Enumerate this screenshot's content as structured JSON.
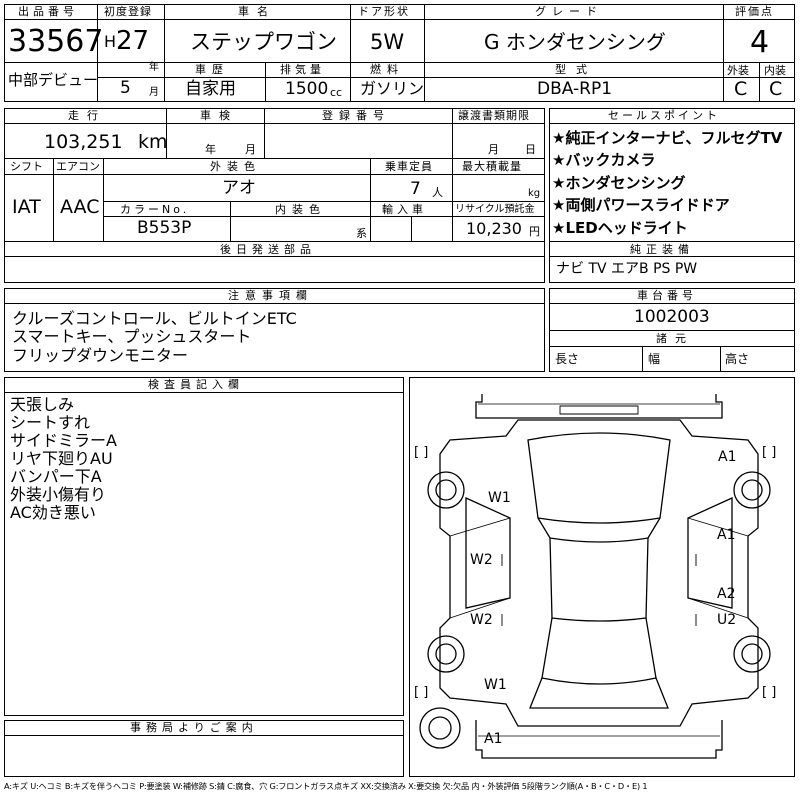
{
  "header": {
    "lot_label": "出品番号",
    "lot_number": "33567",
    "region": "中部デビュー",
    "first_reg_label": "初度登録",
    "era": "H",
    "year": "27",
    "year_unit": "年",
    "month": "5",
    "month_unit": "月",
    "car_name_label": "車名",
    "car_name": "ステップワゴン",
    "door_label": "ドア形状",
    "door": "5W",
    "grade_label": "グレード",
    "grade": "G ホンダセンシング",
    "score_label": "評価点",
    "score": "4",
    "history_label": "車歴",
    "history": "自家用",
    "displacement_label": "排気量",
    "displacement": "1500",
    "displacement_unit": "cc",
    "fuel_label": "燃料",
    "fuel": "ガソリン",
    "model_label": "型式",
    "model": "DBA-RP1",
    "exterior_grade_label": "外装",
    "interior_grade_label": "内装",
    "exterior_grade": "C",
    "interior_grade": "C"
  },
  "row2": {
    "mileage_label": "走行",
    "mileage": "103,251",
    "mileage_unit": "km",
    "inspection_label": "車検",
    "inspection_year_unit": "年",
    "inspection_month_unit": "月",
    "reg_no_label": "登録番号",
    "transfer_label": "譲渡書類期限",
    "transfer_month_unit": "月",
    "transfer_day_unit": "日",
    "shift_label": "シフト",
    "shift": "IAT",
    "ac_label": "エアコン",
    "ac": "AAC",
    "color_label": "外装色",
    "color": "アオ",
    "capacity_label": "乗車定員",
    "capacity": "7",
    "capacity_unit": "人",
    "max_load_label": "最大積載量",
    "max_load_unit": "kg",
    "color_no_label": "カラーNo.",
    "color_no": "B553P",
    "interior_color_label": "内装色",
    "interior_color_unit": "系",
    "import_label": "輸入車",
    "recycle_label": "リサイクル預託金",
    "recycle": "10,230",
    "recycle_unit": "円",
    "later_parts_label": "後日発送部品"
  },
  "sales_points": {
    "label": "セールスポイント",
    "items": [
      "★純正インターナビ、フルセグTV",
      "★バックカメラ",
      "★ホンダセンシング",
      "★両側パワースライドドア",
      "★LEDヘッドライト"
    ]
  },
  "equipment": {
    "label": "純正装備",
    "value": "ナビ TV エアB PS PW"
  },
  "notes": {
    "label": "注意事項欄",
    "lines": [
      "クルーズコントロール、ビルトインETC",
      "スマートキー、プッシュスタート",
      "フリップダウンモニター"
    ]
  },
  "chassis": {
    "label": "車台番号",
    "value": "1002003",
    "dims_label": "諸元",
    "length_label": "長さ",
    "width_label": "幅",
    "height_label": "高さ"
  },
  "inspector": {
    "label": "検査員記入欄",
    "lines": [
      "天張しみ",
      "シートすれ",
      "サイドミラーA",
      "リヤ下廻りAU",
      "バンパー下A",
      "外装小傷有り",
      "AC効き悪い"
    ]
  },
  "office": {
    "label": "事務局よりご案内"
  },
  "diagram": {
    "marks": {
      "w1_upper": "W1",
      "w2_upper": "W2",
      "w2_lower": "W2",
      "w1_lower": "W1",
      "a1_bottom": "A1",
      "a1_top_right": "A1",
      "a1_right_mid": "A1",
      "a2_right": "A2",
      "u2_right": "U2",
      "bracket_ul": "[ ]",
      "bracket_ur": "[ ]",
      "bracket_ll": "[ ]",
      "bracket_lr": "[ ]"
    }
  },
  "footer": {
    "legend": "A:キズ U:ヘコミ B:キズを伴うヘコミ P:要塗装 W:補修跡 S:錆 C:腐食、穴 G:フロントガラス点キズ XX:交換済み X:要交換 欠:欠品 内・外装評価 5段階ランク順(A・B・C・D・E) 1"
  }
}
